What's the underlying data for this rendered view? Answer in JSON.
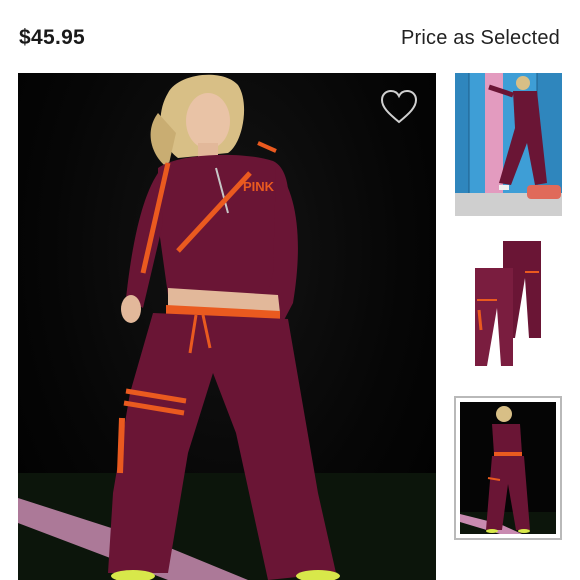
{
  "product": {
    "price": "$45.95",
    "price_note": "Price as Selected"
  },
  "hero": {
    "icon": "heart-outline-icon"
  },
  "thumbnails": [
    {
      "subject": "model-by-lockers"
    },
    {
      "subject": "pants-flat"
    },
    {
      "subject": "model-on-field",
      "selected": true
    }
  ],
  "colors": {
    "garment": "#6a1535",
    "accent": "#ea5a1f",
    "background": "#000000"
  }
}
